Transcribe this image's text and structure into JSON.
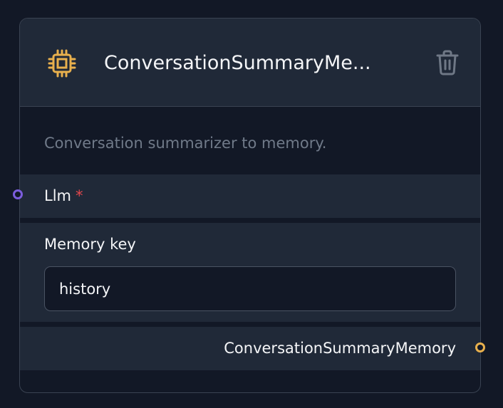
{
  "node": {
    "title": "ConversationSummaryMe...",
    "description": "Conversation summarizer to memory.",
    "icon": "chip-icon",
    "accent_color": "#e8b04d",
    "inputs": {
      "llm_label": "Llm",
      "llm_required_marker": "*"
    },
    "fields": {
      "memory_key_label": "Memory key",
      "memory_key_value": "history"
    },
    "output": {
      "label": "ConversationSummaryMemory"
    }
  }
}
